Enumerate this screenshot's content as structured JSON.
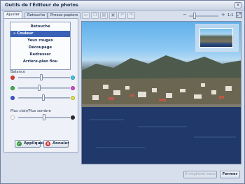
{
  "window": {
    "title": "Outils de l'Éditeur de photos"
  },
  "tabs": [
    {
      "label": "Ajuster",
      "active": true
    },
    {
      "label": "Retouche",
      "active": false
    },
    {
      "label": "Presse-papiers",
      "active": false
    }
  ],
  "menu": {
    "items": [
      {
        "label": "Retouche",
        "selected": false
      },
      {
        "label": "Couleur",
        "selected": true
      },
      {
        "label": "Yeux rouges",
        "selected": false
      },
      {
        "label": "Découpage",
        "selected": false
      },
      {
        "label": "Redresser",
        "selected": false
      },
      {
        "label": "Arrière-plan flou",
        "selected": false
      }
    ],
    "selected_marker": "»"
  },
  "balance": {
    "label": "Balance",
    "sliders": [
      {
        "left_color": "#e23c2c",
        "right_color": "#3fc6e8",
        "level": 0.45
      },
      {
        "left_color": "#3fb445",
        "right_color": "#d24cc8",
        "level": 0.4
      },
      {
        "left_color": "#3b57d6",
        "right_color": "#e8e24a",
        "level": 0.48
      }
    ]
  },
  "brightness": {
    "label": "Plus clair/Plus sombre",
    "left_color": "#ffffff",
    "right_color": "#2a2a2a",
    "level": 0.5
  },
  "buttons": {
    "apply": "Appliquer",
    "cancel": "Annuler",
    "save_as": "Enregistrer sous",
    "close": "Fermer"
  },
  "toolbar": {
    "icons": [
      "new-icon",
      "copy-icon",
      "paste-icon",
      "save-icon",
      "undo-icon",
      "redo-icon"
    ]
  },
  "zoom": {
    "ratio": "1:1",
    "level": 0.15
  },
  "icons": {
    "close": "×",
    "zoom_out": "−",
    "zoom_in": "+",
    "fit": "⤢",
    "apply": "✓",
    "cancel": "×"
  }
}
